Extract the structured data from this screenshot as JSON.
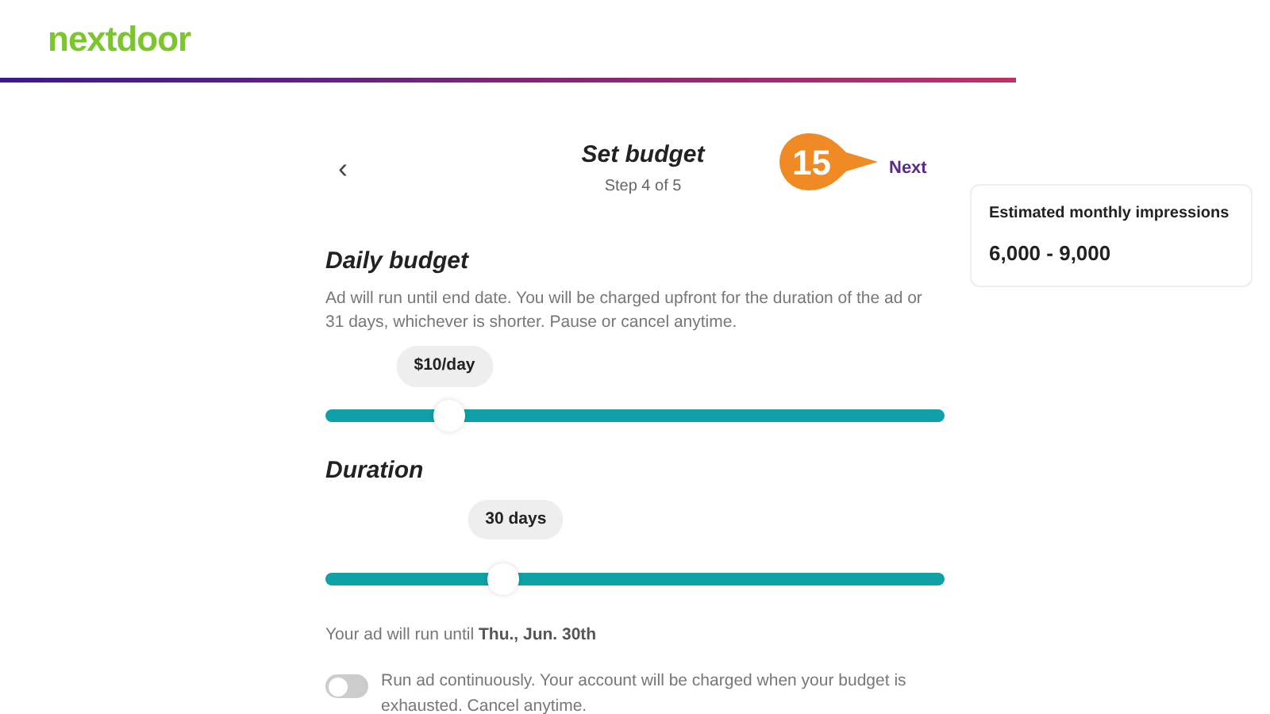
{
  "logo": "nextdoor",
  "header": {
    "back": "‹",
    "title": "Set budget",
    "step": "Step 4 of 5",
    "callout": "15",
    "next": "Next"
  },
  "sections": [
    {
      "title": "Daily budget",
      "description": "Ad will run until end date. You will be charged upfront for the duration of the ad or 31 days, whichever is shorter. Pause or cancel anytime.",
      "slider": {
        "reading": "$10/day",
        "level": 0.2
      }
    },
    {
      "title": "Duration",
      "slider": {
        "reading": "30 days",
        "level": 0.287
      }
    }
  ],
  "end_note": "Your ad will run until **Thu., Jun. 30th**",
  "continuous": {
    "label": "Run ad continuously. Your account will be charged when your budget is exhausted. Cancel anytime.",
    "on": false
  },
  "estimate": {
    "label": "Estimated monthly impressions",
    "value": "6,000 - 9,000"
  }
}
